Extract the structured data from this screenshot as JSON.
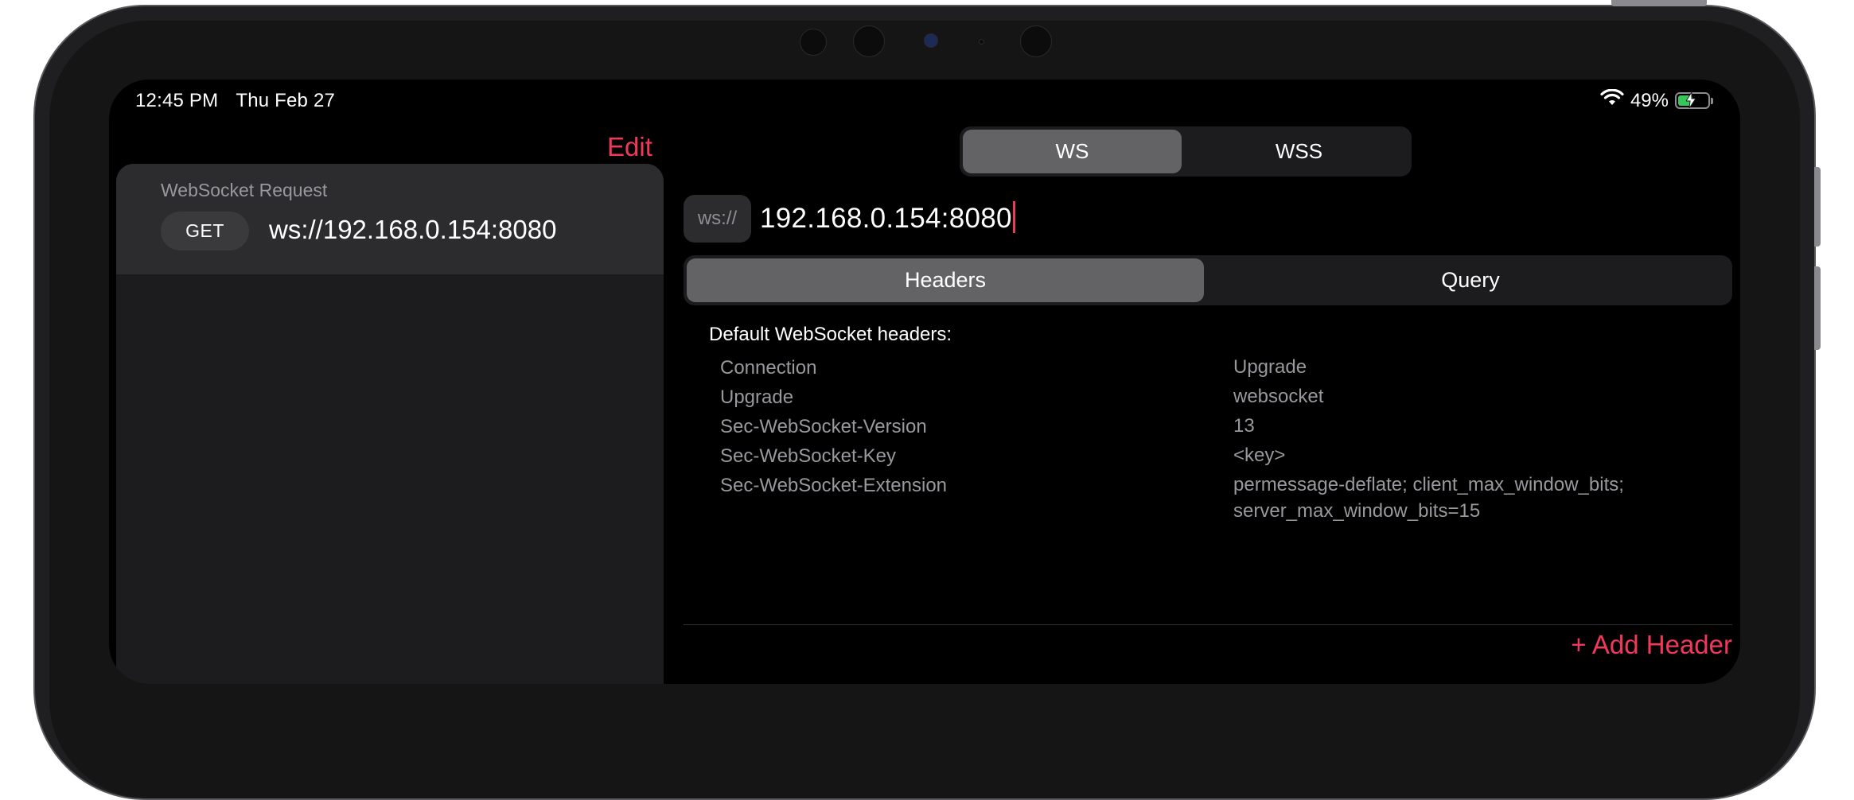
{
  "status": {
    "time": "12:45 PM",
    "date": "Thu Feb 27",
    "battery": "49%"
  },
  "sidebar": {
    "edit_label": "Edit",
    "request": {
      "title": "WebSocket Request",
      "method": "GET",
      "url": "ws://192.168.0.154:8080"
    }
  },
  "protocol": {
    "options": [
      "WS",
      "WSS"
    ],
    "selected": "WS"
  },
  "url_bar": {
    "scheme": "ws://",
    "value": "192.168.0.154:8080"
  },
  "tabs": {
    "options": [
      "Headers",
      "Query"
    ],
    "selected": "Headers"
  },
  "headers": {
    "heading": "Default WebSocket headers:",
    "rows": [
      {
        "key": "Connection",
        "value": "Upgrade"
      },
      {
        "key": "Upgrade",
        "value": "websocket"
      },
      {
        "key": "Sec-WebSocket-Version",
        "value": "13"
      },
      {
        "key": "Sec-WebSocket-Key",
        "value": "<key>"
      },
      {
        "key": "Sec-WebSocket-Extension",
        "value": "permessage-deflate; client_max_window_bits; server_max_window_bits=15"
      }
    ],
    "add_label": "+ Add Header"
  },
  "colors": {
    "accent": "#f2385a",
    "battery_fill": "#34c759"
  },
  "icons": [
    "wifi-icon",
    "battery-icon",
    "charging-bolt-icon"
  ]
}
